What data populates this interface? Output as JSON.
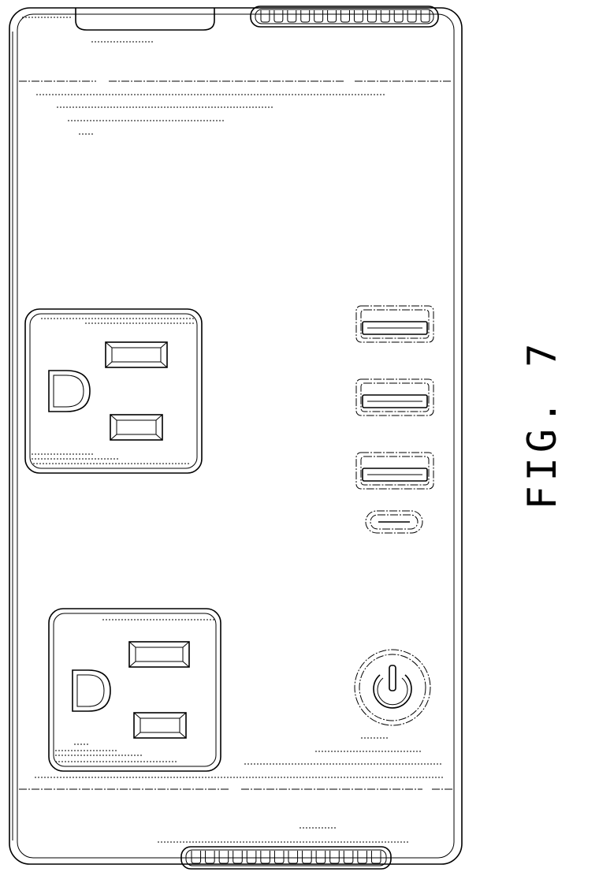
{
  "figure": {
    "label": "FIG. 7"
  },
  "outlets": {
    "count": 2
  },
  "usb_ports": {
    "type_a_count": 3,
    "type_c_count": 1
  }
}
